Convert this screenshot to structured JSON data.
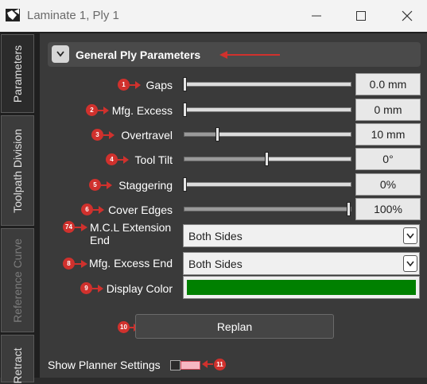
{
  "window": {
    "title": "Laminate 1, Ply 1"
  },
  "tabs": [
    {
      "label": "Parameters",
      "state": "active"
    },
    {
      "label": "Toolpath Division",
      "state": "normal"
    },
    {
      "label": "Reference Curve",
      "state": "disabled"
    },
    {
      "label": "Retract",
      "state": "normal"
    }
  ],
  "section": {
    "title": "General Ply Parameters",
    "collapsed": false
  },
  "sliders": [
    {
      "badge": "1",
      "label": "Gaps",
      "value": "0.0 mm",
      "level": 0.0
    },
    {
      "badge": "2",
      "label": "Mfg. Excess",
      "value": "0 mm",
      "level": 0.0
    },
    {
      "badge": "3",
      "label": "Overtravel",
      "value": "10 mm",
      "level": 0.2
    },
    {
      "badge": "4",
      "label": "Tool Tilt",
      "value": "0°",
      "level": 0.5
    },
    {
      "badge": "5",
      "label": "Staggering",
      "value": "0%",
      "level": 0.0
    },
    {
      "badge": "6",
      "label": "Cover Edges",
      "value": "100%",
      "level": 1.0
    }
  ],
  "combos": [
    {
      "badge": "74",
      "label_line1": "M.C.L Extension",
      "label_line2": "End",
      "value": "Both Sides"
    },
    {
      "badge": "8",
      "label": "Mfg. Excess End",
      "value": "Both Sides"
    }
  ],
  "display_color": {
    "badge": "9",
    "label": "Display Color",
    "color": "#008000"
  },
  "replan": {
    "badge": "10",
    "label": "Replan"
  },
  "planner": {
    "badge": "11",
    "label": "Show Planner Settings"
  },
  "colors": {
    "annotation": "#d0312d",
    "accent": "#008000"
  }
}
